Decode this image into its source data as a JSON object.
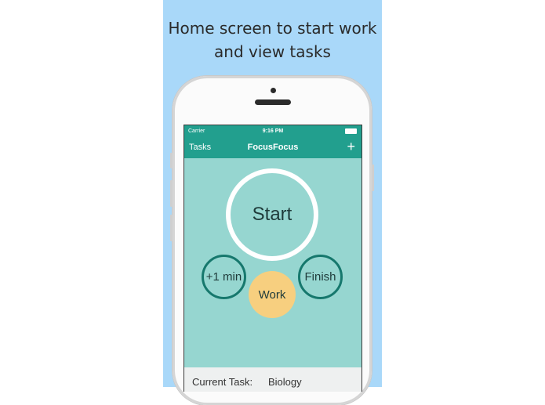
{
  "caption": {
    "line1": "Home screen to start work",
    "line2": "and view tasks"
  },
  "status_bar": {
    "carrier": "Carrier",
    "time": "9:16 PM"
  },
  "nav": {
    "left": "Tasks",
    "title": "FocusFocus",
    "right_icon": "plus-icon"
  },
  "controls": {
    "start": "Start",
    "plus_min": "+1 min",
    "finish": "Finish",
    "work": "Work"
  },
  "footer": {
    "label": "Current Task:",
    "value": "Biology"
  },
  "colors": {
    "background_panel": "#a9d8f9",
    "app_bar": "#229f8e",
    "screen_bg": "#96d6d0",
    "accent_ring": "#16786d",
    "work_bg": "#f7cf7f"
  }
}
